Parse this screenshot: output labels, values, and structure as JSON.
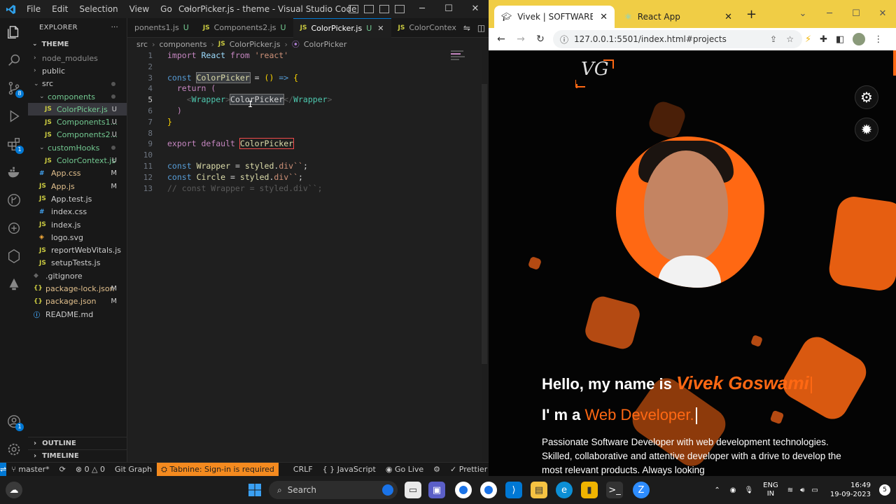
{
  "vscode": {
    "title": "ColorPicker.js - theme - Visual Studio Code",
    "menu": [
      "File",
      "Edit",
      "Selection",
      "View",
      "Go",
      "···"
    ],
    "explorer_label": "EXPLORER",
    "explorer_more": "···",
    "section": "THEME",
    "tree": [
      {
        "label": "node_modules",
        "kind": "folder",
        "indent": 1,
        "status": "",
        "cls": "ign"
      },
      {
        "label": "public",
        "kind": "folder",
        "indent": 1,
        "status": "",
        "cls": ""
      },
      {
        "label": "src",
        "kind": "folder-open",
        "indent": 1,
        "status": "dot",
        "cls": ""
      },
      {
        "label": "components",
        "kind": "folder-open",
        "indent": 2,
        "status": "dot",
        "cls": "u"
      },
      {
        "label": "ColorPicker.js",
        "kind": "js",
        "indent": 3,
        "status": "U",
        "cls": "u",
        "active": true
      },
      {
        "label": "Components1...",
        "kind": "js",
        "indent": 3,
        "status": "U",
        "cls": "u"
      },
      {
        "label": "Components2...",
        "kind": "js",
        "indent": 3,
        "status": "U",
        "cls": "u"
      },
      {
        "label": "customHooks",
        "kind": "folder-open",
        "indent": 2,
        "status": "dot",
        "cls": "u"
      },
      {
        "label": "ColorContext.js",
        "kind": "js",
        "indent": 3,
        "status": "U",
        "cls": "u"
      },
      {
        "label": "App.css",
        "kind": "css",
        "indent": 2,
        "status": "M",
        "cls": "m"
      },
      {
        "label": "App.js",
        "kind": "js",
        "indent": 2,
        "status": "M",
        "cls": "m"
      },
      {
        "label": "App.test.js",
        "kind": "js",
        "indent": 2,
        "status": "",
        "cls": ""
      },
      {
        "label": "index.css",
        "kind": "css",
        "indent": 2,
        "status": "",
        "cls": ""
      },
      {
        "label": "index.js",
        "kind": "js",
        "indent": 2,
        "status": "",
        "cls": ""
      },
      {
        "label": "logo.svg",
        "kind": "svg",
        "indent": 2,
        "status": "",
        "cls": ""
      },
      {
        "label": "reportWebVitals.js",
        "kind": "js",
        "indent": 2,
        "status": "",
        "cls": ""
      },
      {
        "label": "setupTests.js",
        "kind": "js",
        "indent": 2,
        "status": "",
        "cls": ""
      },
      {
        "label": ".gitignore",
        "kind": "git",
        "indent": 1,
        "status": "",
        "cls": ""
      },
      {
        "label": "package-lock.json",
        "kind": "json",
        "indent": 1,
        "status": "M",
        "cls": "m"
      },
      {
        "label": "package.json",
        "kind": "json",
        "indent": 1,
        "status": "M",
        "cls": "m"
      },
      {
        "label": "README.md",
        "kind": "md",
        "indent": 1,
        "status": "",
        "cls": ""
      }
    ],
    "outline": "OUTLINE",
    "timeline": "TIMELINE",
    "tabs": [
      {
        "label": "ponents1.js",
        "status": "U",
        "active": false
      },
      {
        "label": "Components2.js",
        "status": "U",
        "active": false
      },
      {
        "label": "ColorPicker.js",
        "status": "U",
        "active": true
      },
      {
        "label": "ColorContex",
        "status": "",
        "active": false
      }
    ],
    "breadcrumb": [
      "src",
      "components",
      "ColorPicker.js",
      "ColorPicker"
    ],
    "code_lines": [
      1,
      2,
      3,
      4,
      5,
      6,
      7,
      8,
      9,
      10,
      11,
      12,
      13
    ],
    "statusbar": {
      "branch": "master*",
      "errors": "0",
      "warnings": "0",
      "git_graph": "Git Graph",
      "tabnine": "Tabnine: Sign-in is required",
      "eol": "CRLF",
      "language": "JavaScript",
      "golive": "Go Live",
      "prettier": "Prettier"
    }
  },
  "chrome": {
    "tabs": [
      {
        "label": "Vivek | SOFTWARE DEVELO",
        "active": true
      },
      {
        "label": "React App",
        "active": false
      }
    ],
    "url": "127.0.0.1:5501/index.html#projects",
    "page": {
      "logo": "VG",
      "hello_prefix": "Hello, my name is",
      "name": "Vivek Goswami",
      "role_prefix": "I' m a",
      "role": "Web Developer.",
      "bio": "Passionate Software Developer with web development technologies. Skilled, collaborative and attentive developer with a drive to develop the most relevant products. Always looking"
    }
  },
  "taskbar": {
    "search_placeholder": "Search",
    "lang_1": "ENG",
    "lang_2": "IN",
    "time": "16:49",
    "date": "19-09-2023",
    "notification_count": "5"
  },
  "colors": {
    "accent_orange": "#ff6813",
    "vscode_blue": "#0078d4",
    "chrome_tabbar": "#f0cd45"
  }
}
